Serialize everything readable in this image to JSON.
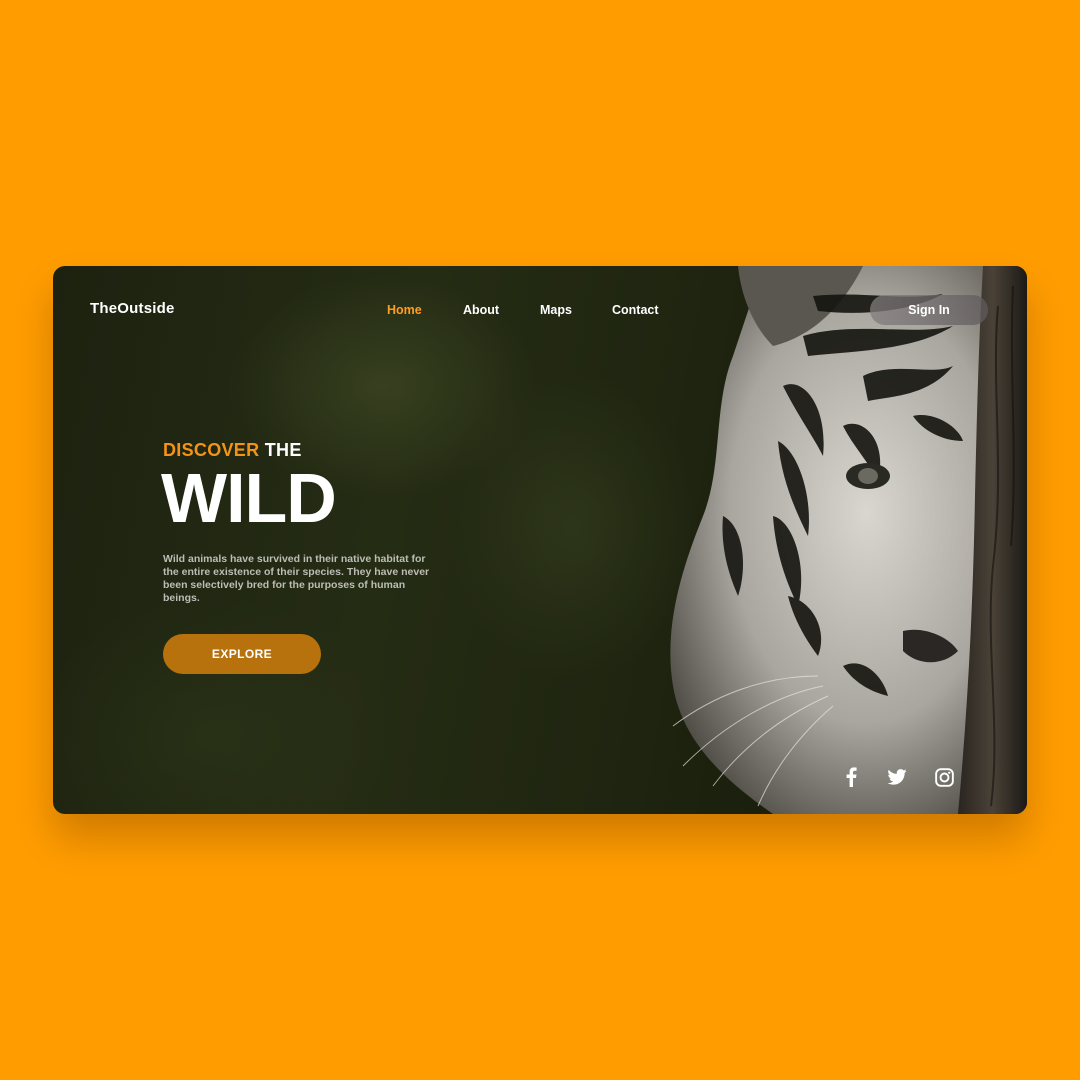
{
  "brand": {
    "name": "TheOutside"
  },
  "nav": {
    "items": [
      {
        "label": "Home",
        "active": true
      },
      {
        "label": "About",
        "active": false
      },
      {
        "label": "Maps",
        "active": false
      },
      {
        "label": "Contact",
        "active": false
      }
    ],
    "sign_in_label": "Sign In"
  },
  "hero": {
    "kicker_accent": "DISCOVER",
    "kicker_rest": "THE",
    "title": "WILD",
    "description": "Wild animals have survived in their native habitat for the entire existence of their species. They have never been selectively bred for the purposes of human beings.",
    "cta_label": "EXPLORE"
  },
  "social": {
    "icons": [
      "facebook-icon",
      "twitter-icon",
      "instagram-icon"
    ]
  },
  "colors": {
    "page_background": "#FF9D00",
    "accent": "#F39416",
    "cta_background": "#B8720D",
    "nav_active": "#FF9D22"
  }
}
